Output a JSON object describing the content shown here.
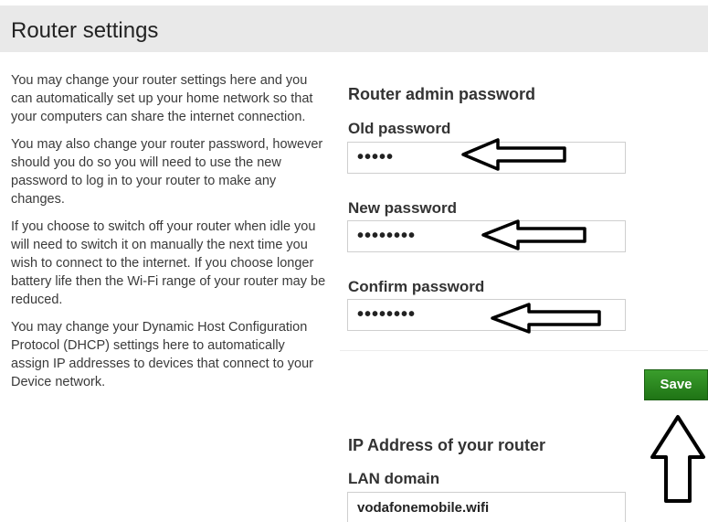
{
  "page": {
    "title": "Router settings"
  },
  "intro": {
    "paragraphs": [
      "You may change your router settings here and you can automatically set up your home network so that your computers can share the internet connection.",
      "You may also change your router password, however should you do so you will need to use the new password to log in to your router to make any changes.",
      "If you choose to switch off your router when idle you will need to switch it on manually the next time you wish to connect to the internet. If you choose longer battery life then the Wi-Fi range of your router may be reduced.",
      "You may change your Dynamic Host Configuration Protocol (DHCP) settings here to automatically assign IP addresses to devices that connect to your Device network."
    ]
  },
  "admin_password": {
    "section_title": "Router admin password",
    "old_label": "Old password",
    "old_value": "•••••",
    "new_label": "New password",
    "new_value": "••••••••",
    "confirm_label": "Confirm password",
    "confirm_value": "••••••••"
  },
  "save_label": "Save",
  "ip_address": {
    "section_title": "IP Address of your router",
    "lan_domain_label": "LAN domain",
    "lan_domain_value": "vodafonemobile.wifi"
  }
}
